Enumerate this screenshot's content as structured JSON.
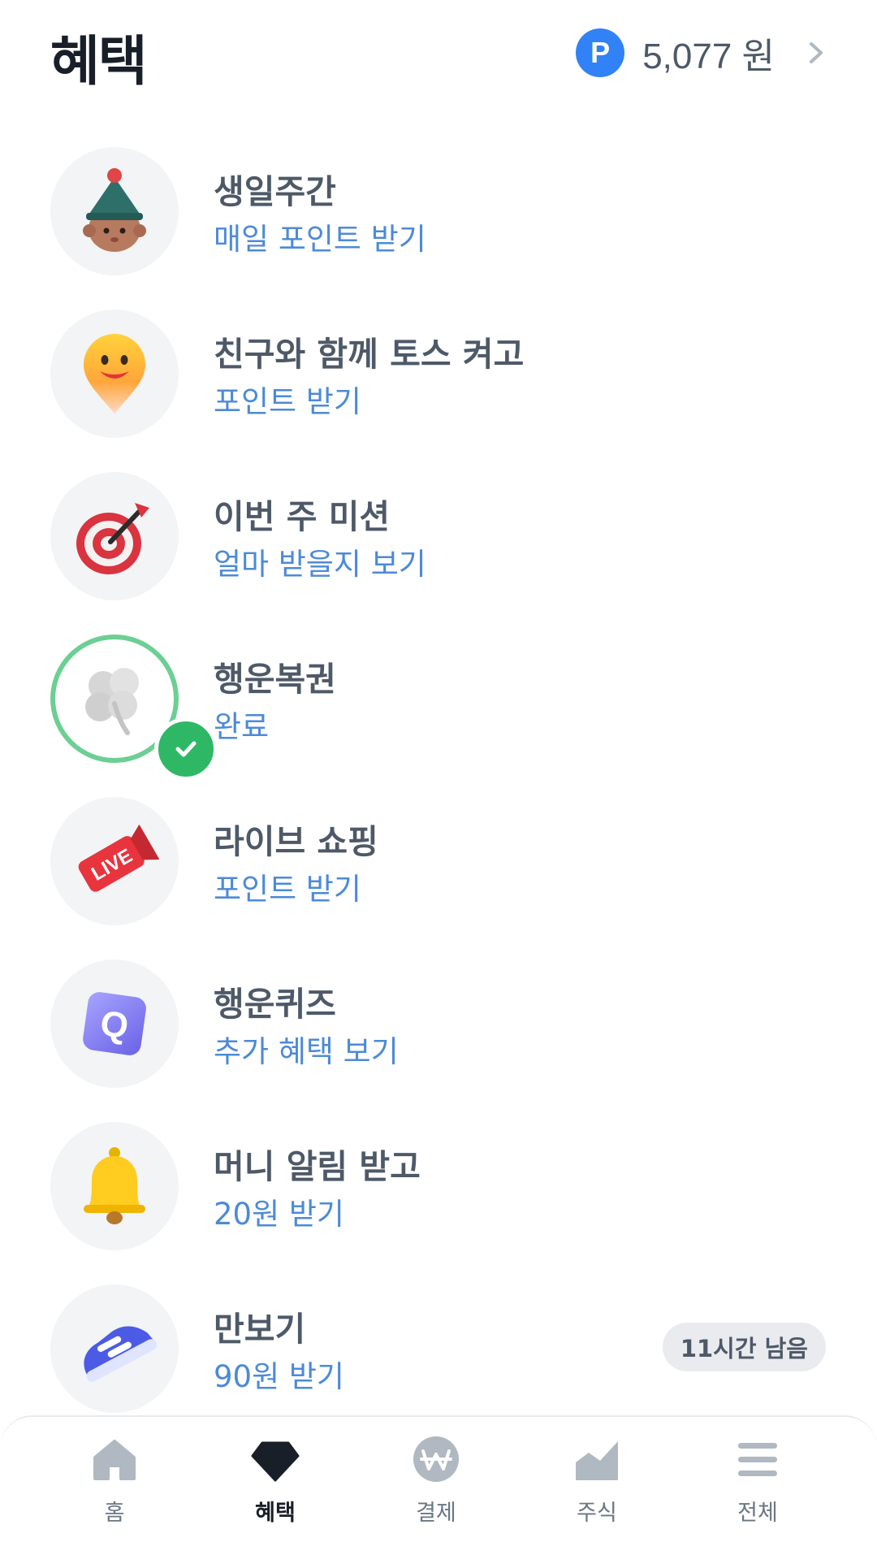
{
  "header": {
    "title": "혜택",
    "points_icon_letter": "P",
    "points_amount": "5,077 원"
  },
  "benefits": [
    {
      "title": "생일주간",
      "subtitle": "매일 포인트 받기",
      "icon": "party-hat-character-icon"
    },
    {
      "title": "친구와 함께 토스 켜고",
      "subtitle": "포인트 받기",
      "icon": "smiley-pin-icon"
    },
    {
      "title": "이번 주 미션",
      "subtitle": "얼마 받을지 보기",
      "icon": "dart-target-icon"
    },
    {
      "title": "행운복권",
      "subtitle": "완료",
      "icon": "clover-icon",
      "completed": true
    },
    {
      "title": "라이브 쇼핑",
      "subtitle": "포인트 받기",
      "icon": "live-megaphone-icon",
      "icon_text": "LIVE"
    },
    {
      "title": "행운퀴즈",
      "subtitle": "추가 혜택 보기",
      "icon": "quiz-q-icon",
      "icon_text": "Q"
    },
    {
      "title": "머니 알림 받고",
      "subtitle": "20원 받기",
      "icon": "bell-icon"
    },
    {
      "title": "만보기",
      "subtitle": "90원 받기",
      "icon": "sneaker-icon",
      "badge": "11시간 남음"
    }
  ],
  "tabbar": [
    {
      "label": "홈",
      "icon": "home-icon",
      "active": false
    },
    {
      "label": "혜택",
      "icon": "gem-icon",
      "active": true
    },
    {
      "label": "결제",
      "icon": "won-coin-icon",
      "active": false
    },
    {
      "label": "주식",
      "icon": "stock-chart-icon",
      "active": false
    },
    {
      "label": "전체",
      "icon": "menu-icon",
      "active": false
    }
  ],
  "colors": {
    "accent_blue": "#3182f6",
    "subtitle_blue": "#4c8ad8",
    "success_green": "#2eb866",
    "success_ring": "#6ccf93",
    "icon_bg": "#f2f4f6"
  }
}
